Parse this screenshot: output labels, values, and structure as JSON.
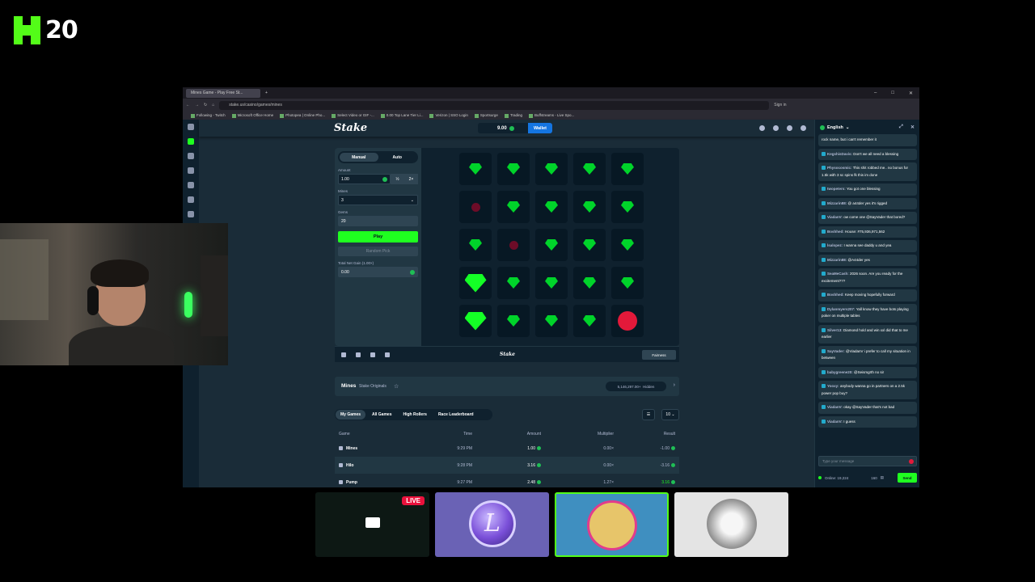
{
  "overlay": {
    "brand_icon": "kick-logo-icon",
    "count": "20"
  },
  "browser": {
    "tab_title": "Mines Game - Play Free St...",
    "url": "stake.us/casino/games/mines",
    "bookmarks": [
      "Following - Twitch",
      "Microsoft Office Home",
      "Photopea | Online Pho...",
      "Select Video or GIF -...",
      "0.00 Top Lane Tier Li...",
      "Verizon | SSO Login",
      "Sportsurge",
      "Trading",
      "Buffstreams - Live Spo..."
    ],
    "sign_in": "Sign in"
  },
  "nav": {
    "logo": "Stake",
    "balance": "9.00",
    "wallet": "Wallet"
  },
  "panel": {
    "mode_manual": "Manual",
    "mode_auto": "Auto",
    "amount_label": "Amount",
    "amount_value": "1.00",
    "half": "½",
    "double": "2×",
    "mines_label": "Mines",
    "mines_value": "3",
    "gems_label": "Gems",
    "gems_value": "20",
    "play": "Play",
    "random_pick": "Random Pick",
    "profit_label": "Total Net Gain (1.00×)",
    "profit_value": "0.00"
  },
  "grid": [
    [
      "gem",
      "gem",
      "gem",
      "gem",
      "gem"
    ],
    [
      "mine",
      "gem",
      "gem",
      "gem",
      "gem"
    ],
    [
      "gem",
      "mine",
      "gem",
      "gem",
      "gem"
    ],
    [
      "gem-big",
      "gem",
      "gem",
      "gem",
      "gem"
    ],
    [
      "gem-big",
      "gem",
      "gem",
      "gem",
      "mine-big"
    ]
  ],
  "game_footer": {
    "logo": "Stake",
    "fairness": "Fairness"
  },
  "info": {
    "title": "Mines",
    "subtitle": "Stake Originals",
    "house": "5,146,297.00+",
    "house_label": "Hidden"
  },
  "history_tabs": [
    "My Games",
    "All Games",
    "High Rollers",
    "Race Leaderboard"
  ],
  "page_size": "10",
  "table": {
    "headers": [
      "Game",
      "Time",
      "Amount",
      "Multiplier",
      "Result"
    ],
    "rows": [
      {
        "game": "Mines",
        "time": "9:29 PM",
        "amount": "1.00",
        "multiplier": "0.00×",
        "result": "-1.00"
      },
      {
        "game": "Hilo",
        "time": "9:28 PM",
        "amount": "3.16",
        "multiplier": "0.00×",
        "result": "-3.16"
      },
      {
        "game": "Pump",
        "time": "9:27 PM",
        "amount": "2.48",
        "multiplier": "1.27×",
        "result": "3.16"
      }
    ]
  },
  "chat": {
    "language": "English",
    "messages": [
      {
        "user": "",
        "text": "rock name, but i can't remember it"
      },
      {
        "user": "KegshisDavis:",
        "text": "Don't we all need a blessing"
      },
      {
        "user": "Physocosmic:",
        "text": "This shit robbed me.. no bonus for 1.5k with 3 sc spins fk this im done"
      },
      {
        "user": "twopeters:",
        "text": "You got one blessing"
      },
      {
        "user": "Mizzarin88:",
        "text": "@ a44der yes it's rigged"
      },
      {
        "user": "ViadanV:",
        "text": "ow come one @SayVader that bored?"
      },
      {
        "user": "Boshhed:",
        "text": "House: #75,936,971,562"
      },
      {
        "user": "lsalopez:",
        "text": "I wanna see daddy u and yea"
      },
      {
        "user": "Mizzarin88:",
        "text": "@A44der yes"
      },
      {
        "user": "SeaMeCash:",
        "text": "2026 soon. Are you ready for the excitement???"
      },
      {
        "user": "Boshhed:",
        "text": "Keep moving hopefully forward"
      },
      {
        "user": "Dylanmyers207:",
        "text": "Yall know they have bots playing poker on multiple tables"
      },
      {
        "user": "Silver13:",
        "text": "Diamond hold and win xxl did that to me earlier"
      },
      {
        "user": "SayVader:",
        "text": "@ViadanV i prefer to call my situation in between"
      },
      {
        "user": "babygreene20:",
        "text": "@Seismgrth no sir"
      },
      {
        "user": "Yooxy:",
        "text": "anybody wanna go in partners on a 2.5k power pop buy?"
      },
      {
        "user": "ViadanV:",
        "text": "okay @SayVader that's not bad"
      },
      {
        "user": "ViadanV:",
        "text": "I guess"
      }
    ],
    "placeholder": "Type your message",
    "online": "Online: 19,224",
    "count": "160",
    "send": "Send"
  },
  "stream": {
    "live": "LIVE"
  }
}
